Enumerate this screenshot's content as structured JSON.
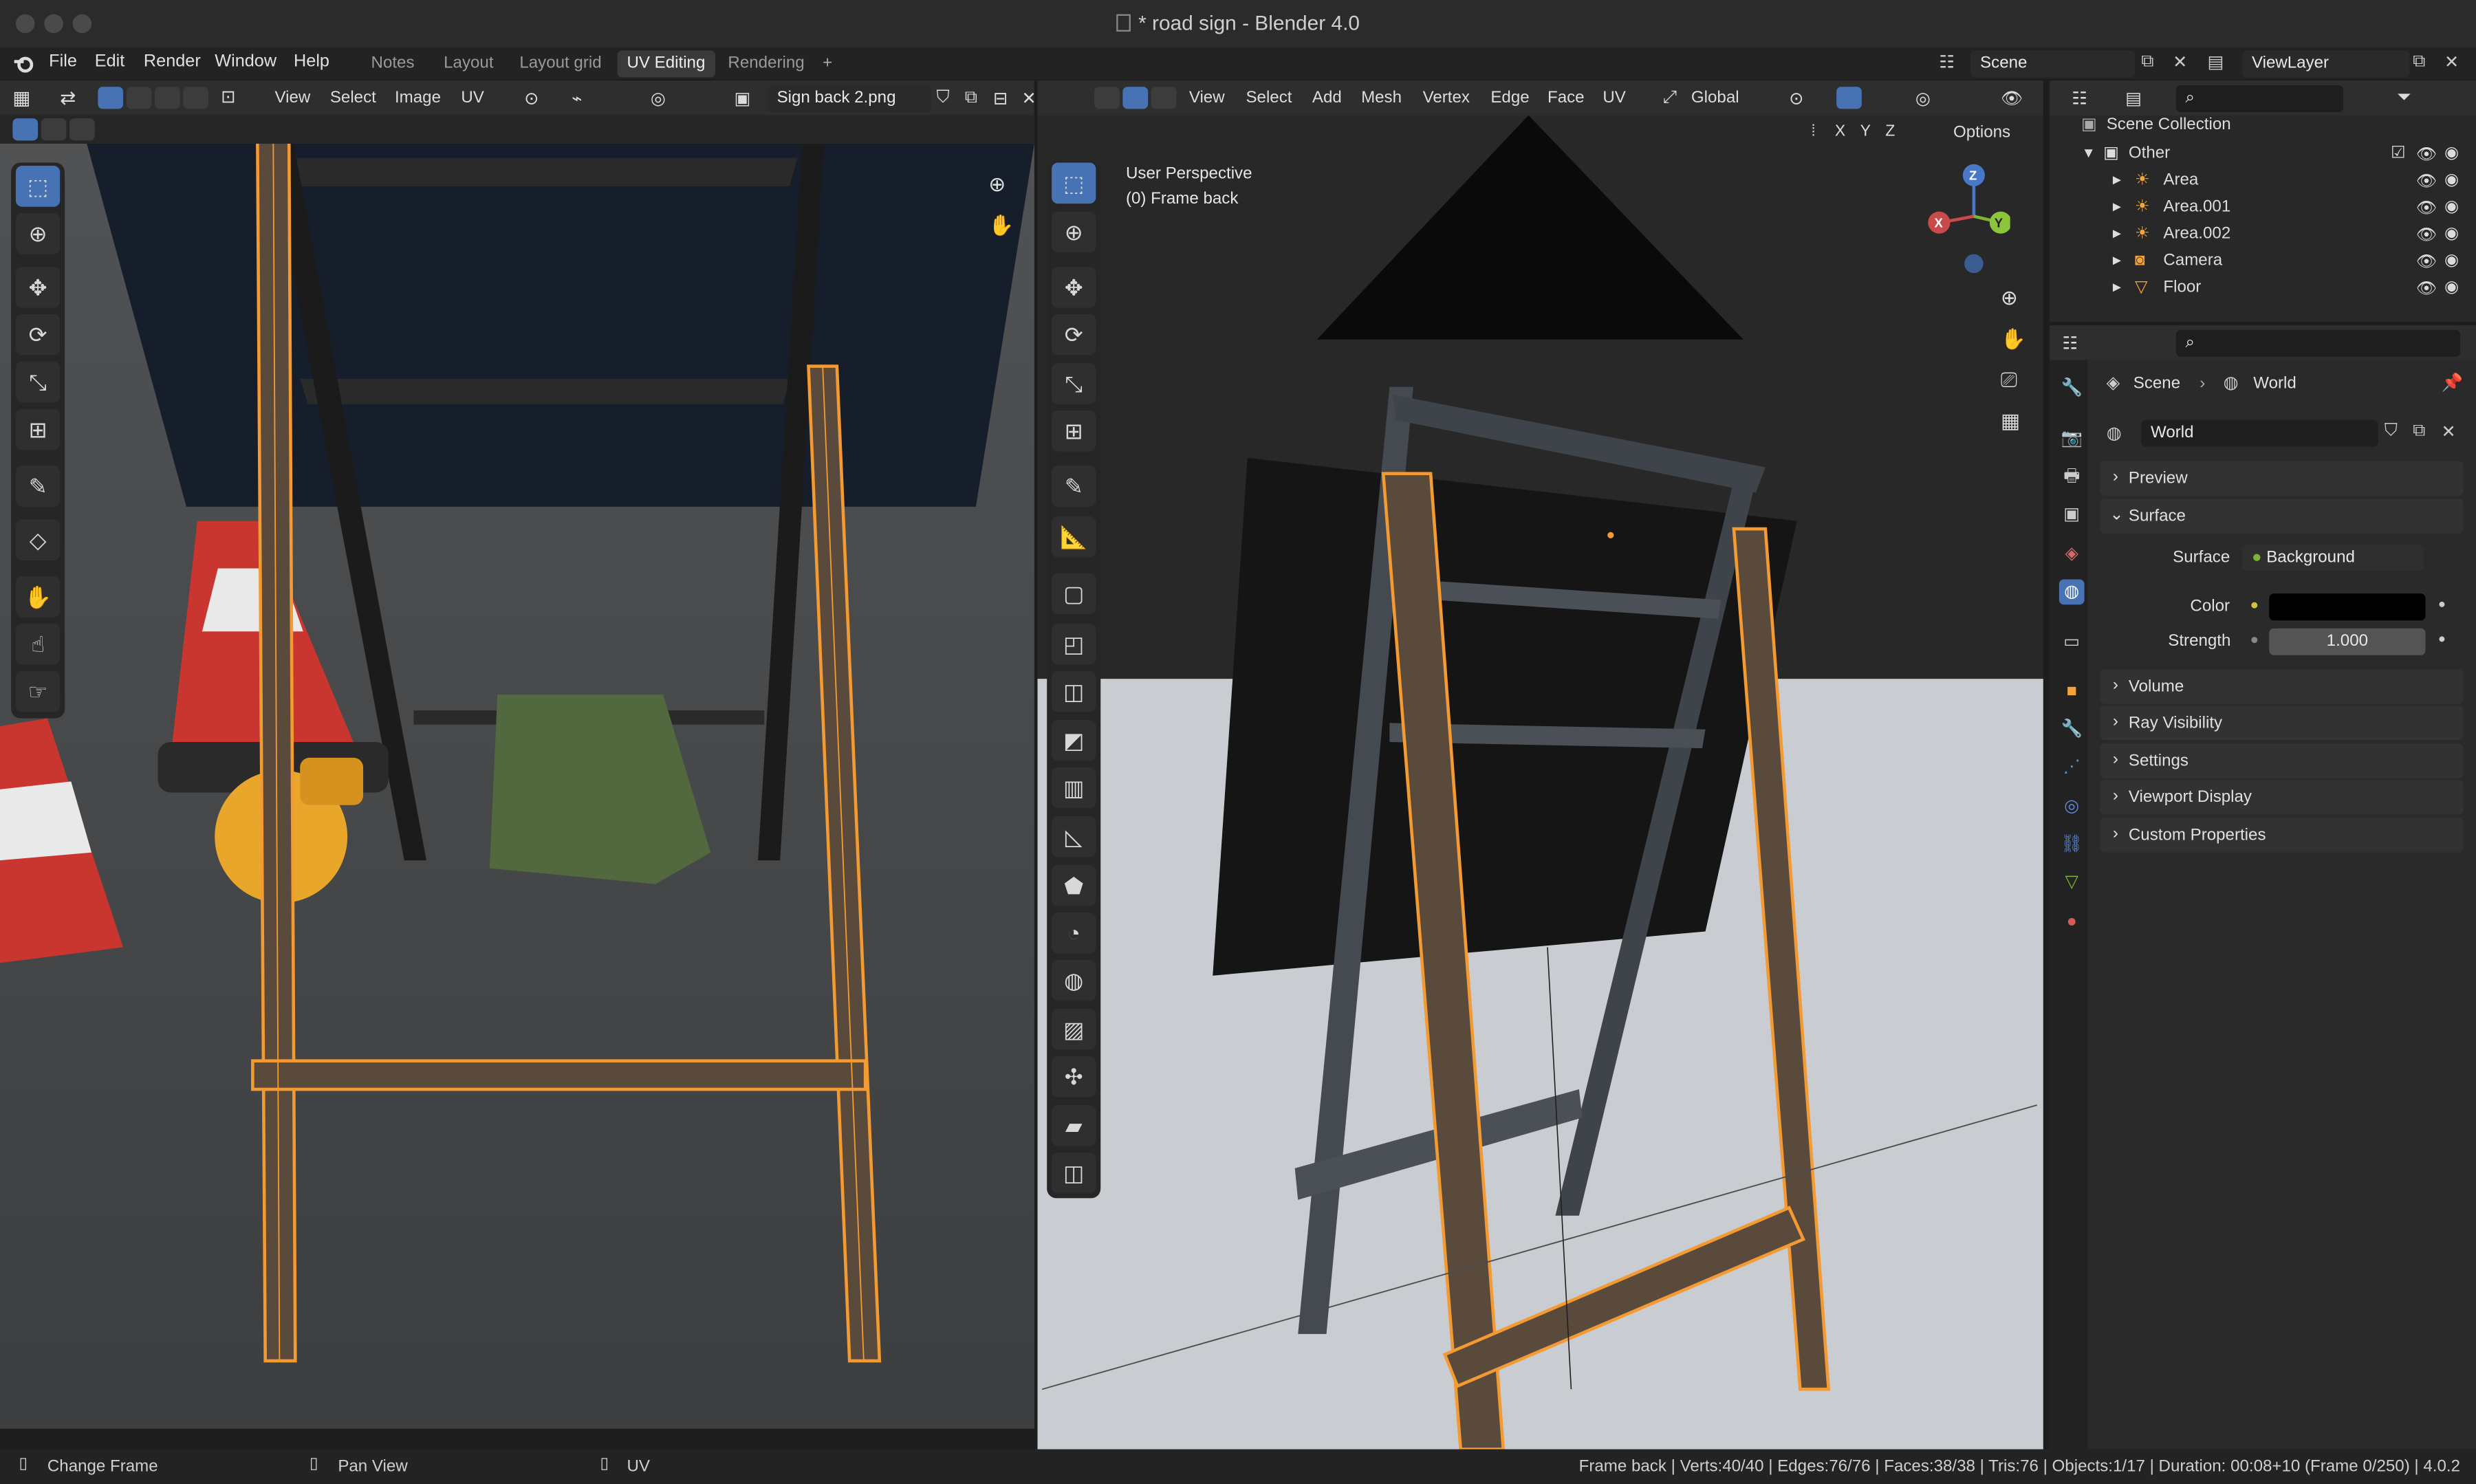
{
  "window": {
    "title": "* road sign - Blender 4.0"
  },
  "menu": {
    "items": [
      "File",
      "Edit",
      "Render",
      "Window",
      "Help"
    ],
    "workspaces": [
      "Notes",
      "Layout",
      "Layout grid",
      "UV Editing",
      "Rendering"
    ],
    "add": "+",
    "scene": "Scene",
    "viewlayer": "ViewLayer"
  },
  "uv_editor": {
    "menus": [
      "View",
      "Select",
      "Image",
      "UV"
    ],
    "image_name": "Sign back 2.png"
  },
  "viewport": {
    "menus": [
      "View",
      "Select",
      "Add",
      "Mesh",
      "Vertex",
      "Edge",
      "Face",
      "UV"
    ],
    "orientation": "Global",
    "axes": [
      "X",
      "Y",
      "Z"
    ],
    "options": "Options",
    "overlay_title": "User Perspective",
    "overlay_sub": "(0) Frame back",
    "gizmo": {
      "x": "X",
      "y": "Y",
      "z": "Z"
    }
  },
  "outliner": {
    "root": "Scene Collection",
    "collection": "Other",
    "items": [
      "Area",
      "Area.001",
      "Area.002",
      "Camera",
      "Floor"
    ]
  },
  "properties": {
    "breadcrumb_scene": "Scene",
    "breadcrumb_world": "World",
    "world_name": "World",
    "panels": {
      "preview": "Preview",
      "surface": "Surface",
      "volume": "Volume",
      "ray_visibility": "Ray Visibility",
      "settings": "Settings",
      "viewport_display": "Viewport Display",
      "custom_properties": "Custom Properties"
    },
    "surface_label": "Surface",
    "surface_value": "Background",
    "color_label": "Color",
    "color_value": "#000000",
    "strength_label": "Strength",
    "strength_value": "1.000"
  },
  "status": {
    "left1": "Change Frame",
    "left2": "Pan View",
    "left3": "UV",
    "right": "Frame back | Verts:40/40 | Edges:76/76 | Faces:38/38 | Tris:76 | Objects:1/17 | Duration: 00:08+10 (Frame 0/250) | 4.0.2"
  },
  "colors": {
    "accent": "#4772b3",
    "selection": "#f39a33",
    "header": "#2e2e2e"
  }
}
